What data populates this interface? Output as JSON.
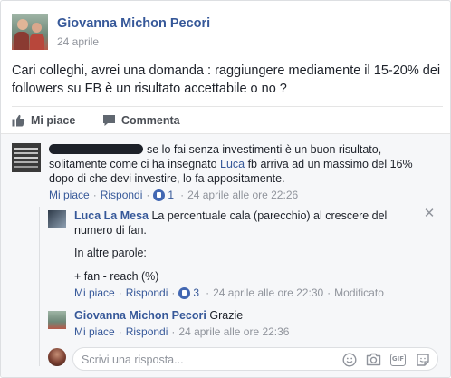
{
  "post": {
    "author": "Giovanna Michon Pecori",
    "date": "24 aprile",
    "text": "Cari colleghi, avrei una domanda : raggiungere mediamente il 15-20% dei followers su FB è un risultato accettabile o no ?"
  },
  "actions": {
    "like_label": "Mi piace",
    "comment_label": "Commenta"
  },
  "comments": [
    {
      "text_before_link": "se lo fai senza investimenti è un buon risultato, solitamente come ci ha insegnato ",
      "link_text": "Luca",
      "text_after_link": " fb arriva ad un massimo del 16% dopo di che devi investire, lo fa appositamente.",
      "like_label": "Mi piace",
      "reply_label": "Rispondi",
      "like_count": "1",
      "time": "24 aprile alle ore 22:26"
    }
  ],
  "replies": [
    {
      "author": "Luca La Mesa",
      "text": "La percentuale cala (parecchio) al crescere del numero di fan.",
      "paragraph2": "In altre parole:",
      "paragraph3": "+ fan - reach (%)",
      "like_label": "Mi piace",
      "reply_label": "Rispondi",
      "like_count": "3",
      "time": "24 aprile alle ore 22:30",
      "edited": "Modificato"
    },
    {
      "author": "Giovanna Michon Pecori",
      "text": "Grazie",
      "like_label": "Mi piace",
      "reply_label": "Rispondi",
      "time": "24 aprile alle ore 22:36"
    }
  ],
  "reply_input": {
    "placeholder": "Scrivi una risposta..."
  },
  "icons": {
    "close": "close-icon",
    "gif_label": "GIF"
  },
  "colors": {
    "link": "#365899",
    "like_badge": "#4267b2",
    "meta": "#90949c"
  }
}
